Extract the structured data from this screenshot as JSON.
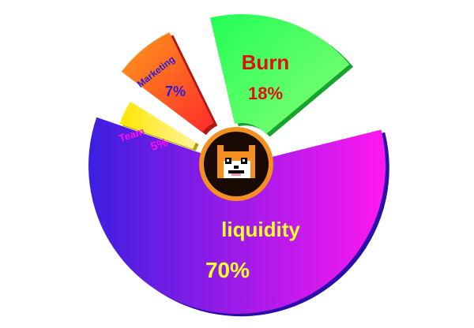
{
  "chart_data": {
    "type": "pie",
    "title": "",
    "slices": [
      {
        "label": "liquidity",
        "value": 70,
        "value_label": "70%",
        "color_start": "#3b1fe0",
        "color_end": "#ff18f0",
        "side_color": "#2a10a8",
        "text_color": "#ffff2a"
      },
      {
        "label": "Team",
        "value": 5,
        "value_label": "5%",
        "color_start": "#ffe600",
        "color_end": "#fff59a",
        "side_color": "#b8a000",
        "text_color": "#ff10ee"
      },
      {
        "label": "Marketing",
        "value": 7,
        "value_label": "7%",
        "color_start": "#ff2b2b",
        "color_end": "#ff9a1a",
        "side_color": "#b01818",
        "text_color": "#2a1cd8"
      },
      {
        "label": "Burn",
        "value": 18,
        "value_label": "18%",
        "color_start": "#22ff55",
        "color_end": "#88ff77",
        "side_color": "#18a330",
        "text_color": "#e01010"
      }
    ],
    "center_logo": "pixel-cat-face",
    "ring_color": "#f3901f",
    "center_color": "#1a0a04"
  }
}
